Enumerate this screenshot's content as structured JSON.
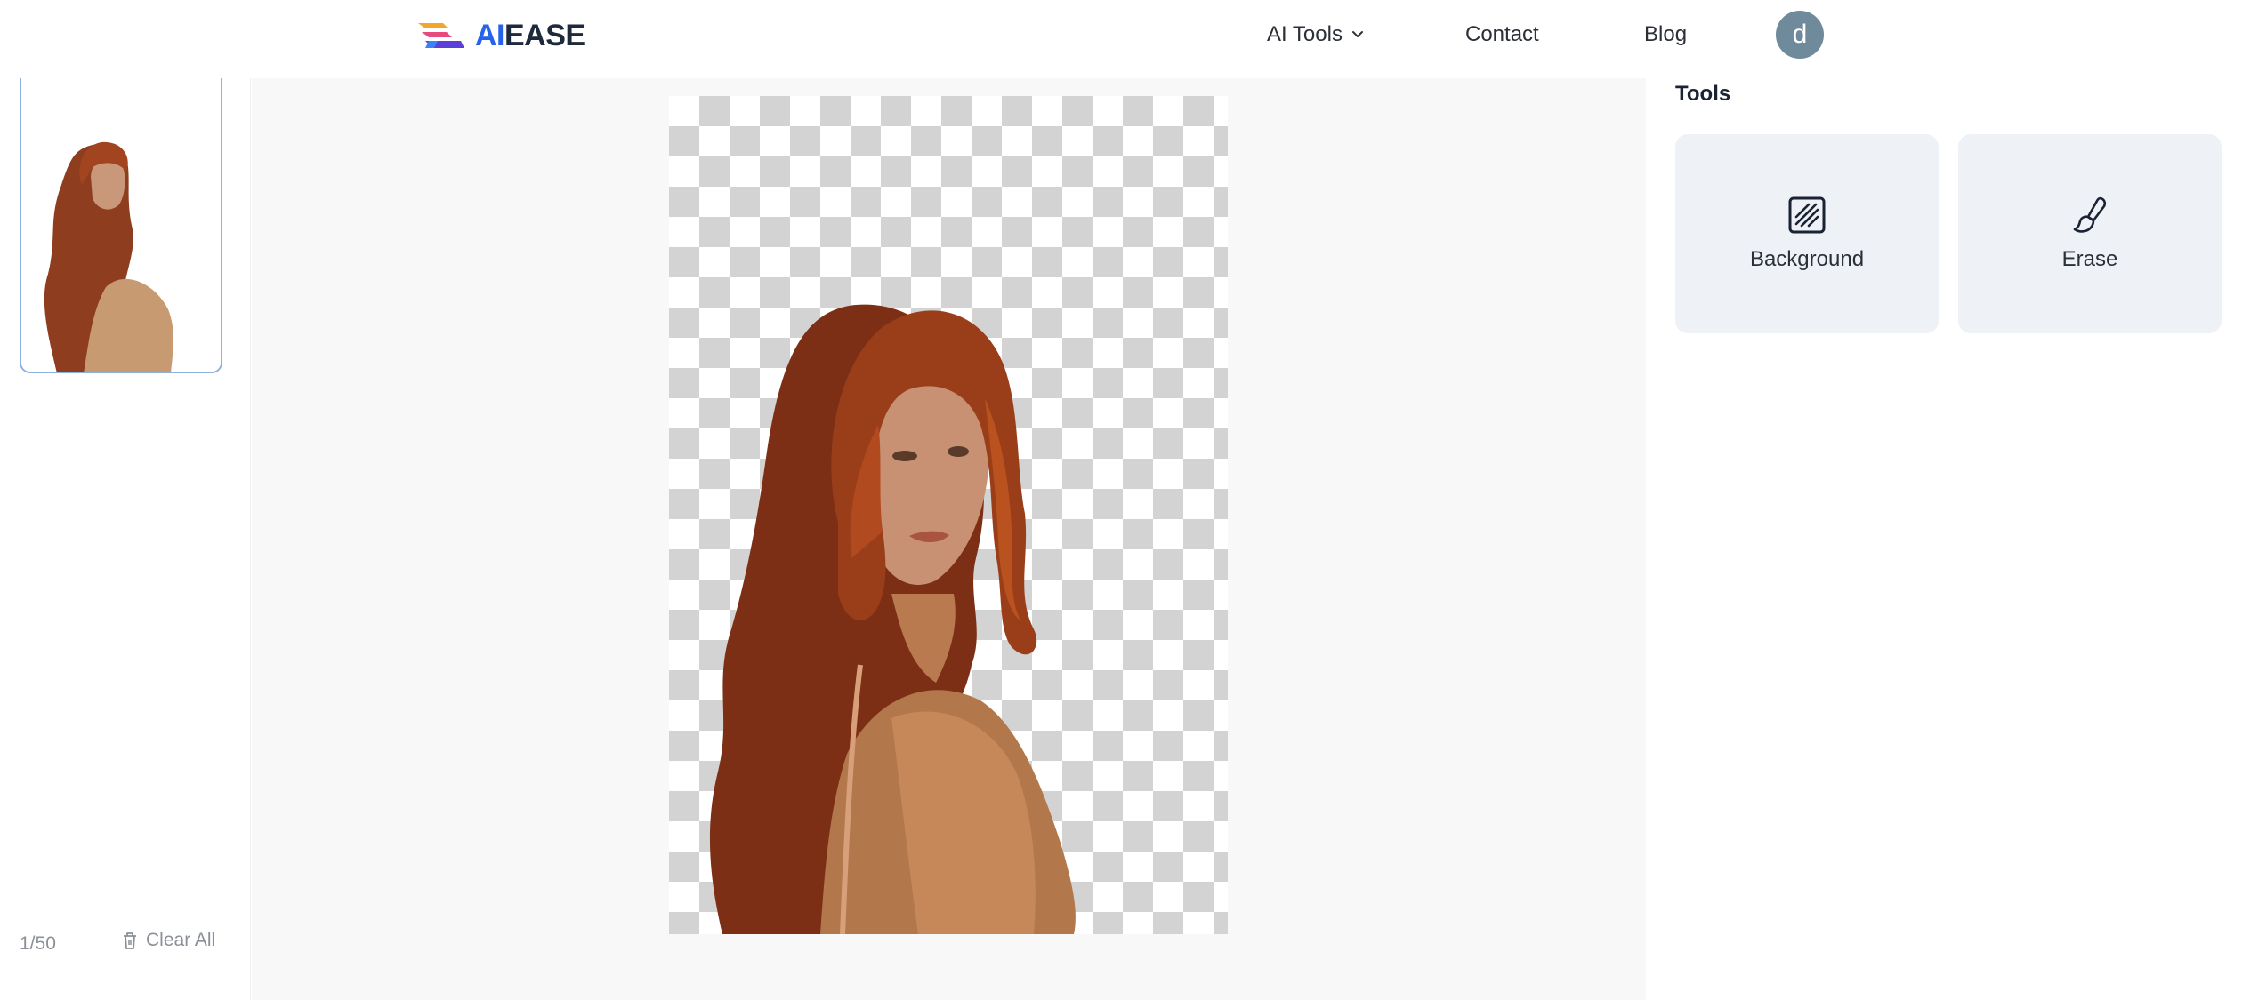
{
  "header": {
    "brand_ai": "AI",
    "brand_rest": "EASE",
    "nav": {
      "ai_tools": "AI Tools",
      "contact": "Contact",
      "blog": "Blog"
    },
    "avatar_letter": "d"
  },
  "left_panel": {
    "counter": "1/50",
    "clear_all": "Clear All"
  },
  "right_panel": {
    "title": "Tools",
    "tools": [
      {
        "label": "Background",
        "icon": "background-pattern-icon"
      },
      {
        "label": "Erase",
        "icon": "brush-icon"
      }
    ]
  },
  "colors": {
    "brand_blue": "#2563eb",
    "avatar": "#6f8a9a",
    "tool_card": "#eef2f7",
    "thumb_border": "#8fb1e0"
  }
}
